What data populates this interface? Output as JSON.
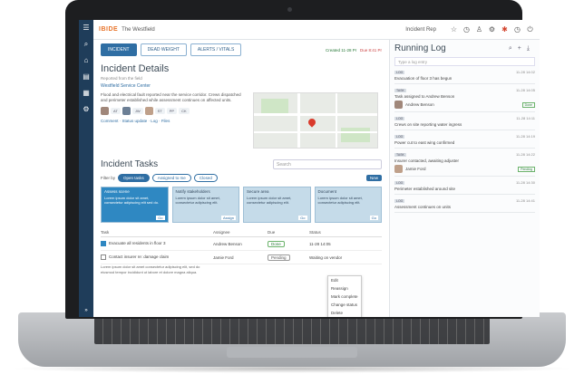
{
  "topbar": {
    "logo": "IBIDE",
    "workspace": "The Westfield",
    "user": "Incident Rep"
  },
  "tabs": [
    "INCIDENT",
    "DEAD WEIGHT",
    "ALERTS / VITALS"
  ],
  "meta": {
    "created_label": "Created 11-28 Pr",
    "due_label": "Due 8:41 Pr"
  },
  "incident": {
    "title": "Incident Details",
    "subtitle": "Reported from the field",
    "address": "Westfield Service Center",
    "description": "Flood and electrical fault reported near the service corridor. Crews dispatched and perimeter established while assessment continues on affected units.",
    "people": [
      "AT",
      "JW",
      "ST",
      "PP",
      "CK"
    ],
    "links": [
      "Comment",
      "Status update",
      "Log",
      "Files"
    ]
  },
  "tasks": {
    "title": "Incident Tasks",
    "search_placeholder": "Search",
    "filter_label": "Filter by",
    "filters": [
      "Open tasks",
      "Assigned to me",
      "Closed"
    ],
    "new_label": "New",
    "cards": [
      {
        "title": "Assess scene",
        "text": "Lorem ipsum dolor sit amet, consectetur adipiscing elit sed do.",
        "action": "Go"
      },
      {
        "title": "Notify stakeholders",
        "text": "Lorem ipsum dolor sit amet, consectetur adipiscing elit.",
        "action": "Assign"
      },
      {
        "title": "Secure area",
        "text": "Lorem ipsum dolor sit amet, consectetur adipiscing elit.",
        "action": "Go"
      },
      {
        "title": "Document",
        "text": "Lorem ipsum dolor sit amet, consectetur adipiscing elit.",
        "action": "Go"
      }
    ],
    "columns": [
      "Task",
      "Assignee",
      "Due",
      "Status"
    ],
    "rows": [
      {
        "task": "Evacuate all residents in floor 3",
        "assignee": "Andrew Benson",
        "due": "Done",
        "status": "11-28 14:05"
      },
      {
        "task": "Contact insurer re: damage claim",
        "assignee": "Jamie Ford",
        "due": "Pending",
        "status": "Waiting on vendor"
      }
    ],
    "long_text": "Lorem ipsum dolor sit amet consectetur adipiscing elit, sed do eiusmod tempor incididunt ut labore et dolore magna aliqua.",
    "menu": [
      "Edit",
      "Reassign",
      "Mark complete",
      "Change status",
      "Delete"
    ]
  },
  "running_log": {
    "title": "Running Log",
    "input_placeholder": "Type a log entry",
    "entries": [
      {
        "badge": "LOG",
        "time": "11-28 14:02",
        "text": "Evacuation of floor 3 has begun"
      },
      {
        "badge": "TASK",
        "time": "11-28 14:05",
        "text": "Task assigned to Andrew Benson",
        "who": "Andrew Benson",
        "tag": "Done"
      },
      {
        "badge": "LOG",
        "time": "11-28 14:11",
        "text": "Crews on site reporting water ingress"
      },
      {
        "badge": "LOG",
        "time": "11-28 14:19",
        "text": "Power cut to east wing confirmed"
      },
      {
        "badge": "TASK",
        "time": "11-28 14:22",
        "text": "Insurer contacted, awaiting adjuster",
        "who": "Jamie Ford",
        "tag": "Pending"
      },
      {
        "badge": "LOG",
        "time": "11-28 14:30",
        "text": "Perimeter established around site"
      },
      {
        "badge": "LOG",
        "time": "11-28 14:41",
        "text": "Assessment continues on units"
      }
    ]
  }
}
